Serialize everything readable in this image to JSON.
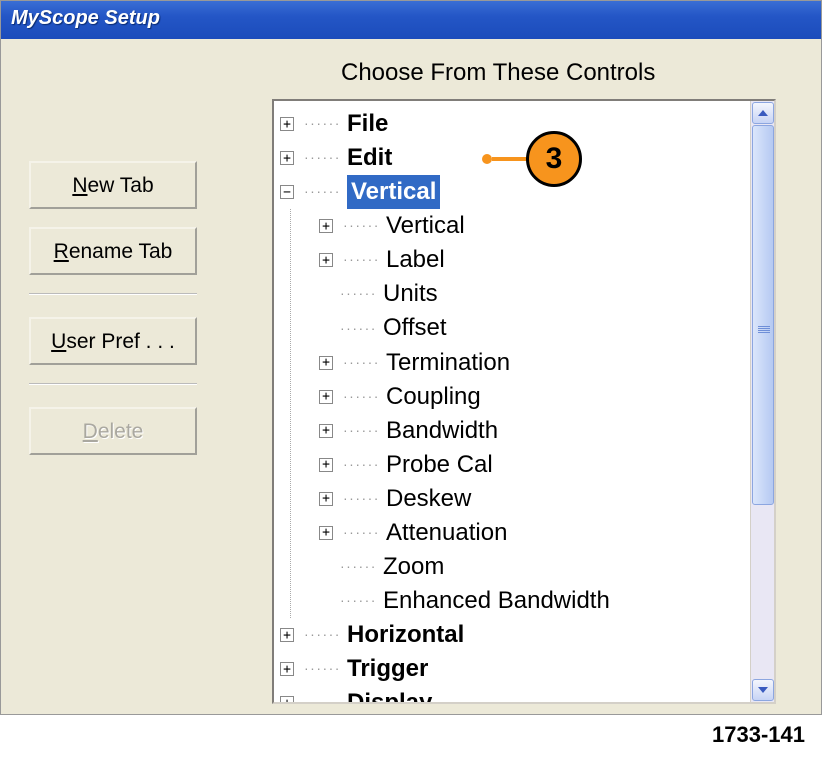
{
  "window": {
    "title": "MyScope Setup"
  },
  "buttons": {
    "new_tab": "New Tab",
    "rename_tab": "Rename Tab",
    "user_pref": "User Pref . . .",
    "delete": "Delete"
  },
  "section_title": "Choose From These Controls",
  "tree": {
    "top": [
      {
        "label": "File",
        "bold": true,
        "expander": "+"
      },
      {
        "label": "Edit",
        "bold": true,
        "expander": "+"
      }
    ],
    "vertical": {
      "label": "Vertical",
      "bold": true,
      "expander": "-",
      "selected": true
    },
    "vertical_children": [
      {
        "label": "Vertical",
        "expander": "+"
      },
      {
        "label": "Label",
        "expander": "+"
      },
      {
        "label": "Units",
        "expander": null
      },
      {
        "label": "Offset",
        "expander": null
      },
      {
        "label": "Termination",
        "expander": "+"
      },
      {
        "label": "Coupling",
        "expander": "+"
      },
      {
        "label": "Bandwidth",
        "expander": "+"
      },
      {
        "label": "Probe Cal",
        "expander": "+"
      },
      {
        "label": "Deskew",
        "expander": "+"
      },
      {
        "label": "Attenuation",
        "expander": "+"
      },
      {
        "label": "Zoom",
        "expander": null
      },
      {
        "label": "Enhanced Bandwidth",
        "expander": null
      }
    ],
    "bottom": [
      {
        "label": "Horizontal",
        "bold": true,
        "expander": "+"
      },
      {
        "label": "Trigger",
        "bold": true,
        "expander": "+"
      },
      {
        "label": "Display",
        "bold": true,
        "expander": "+"
      }
    ]
  },
  "callout": {
    "number": "3"
  },
  "figure_id": "1733-141"
}
